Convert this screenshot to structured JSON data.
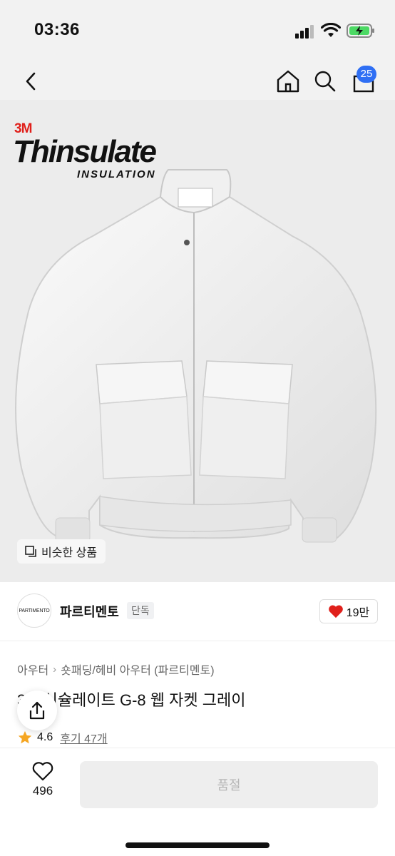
{
  "status_bar": {
    "time": "03:36"
  },
  "nav": {
    "cart_count": "25"
  },
  "image": {
    "logo_brand": "3M",
    "logo_main": "Thinsulate",
    "logo_sub": "INSULATION",
    "similar_label": "비슷한 상품"
  },
  "brand": {
    "avatar_text": "PARTIMENTO",
    "name": "파르티멘토",
    "badge": "단독",
    "likes": "19만"
  },
  "breadcrumb": {
    "category": "아우터",
    "subcategory": "숏패딩/헤비 아우터 (파르티멘토)"
  },
  "product": {
    "title": "3M 신슐레이트 G-8 웹 자켓 그레이",
    "rating": "4.6",
    "reviews": "후기 47개"
  },
  "bottom": {
    "wish_count": "496",
    "soldout_label": "품절"
  },
  "colors": {
    "accent": "#2f6ff4",
    "heart": "#e0201b",
    "star": "#f5a623"
  }
}
